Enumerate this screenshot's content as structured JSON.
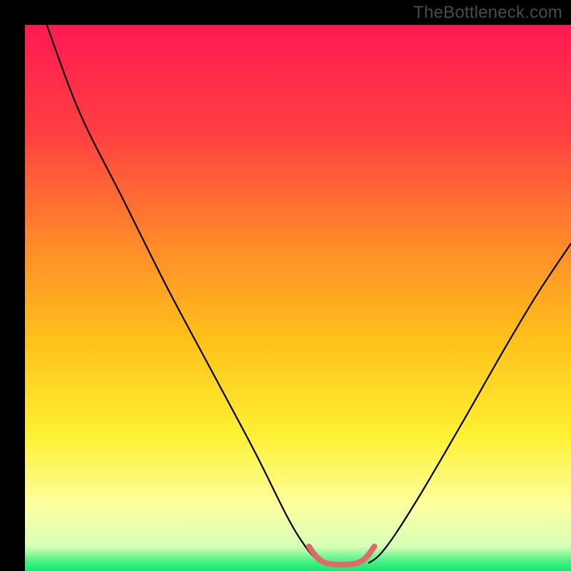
{
  "watermark": "TheBottleneck.com",
  "chart_data": {
    "type": "line",
    "title": "",
    "xlabel": "",
    "ylabel": "",
    "xlim": [
      0,
      100
    ],
    "ylim": [
      0,
      100
    ],
    "grid": false,
    "legend": false,
    "background_gradient": {
      "stops": [
        {
          "offset": 0.0,
          "color": "#ff1a52"
        },
        {
          "offset": 0.2,
          "color": "#ff4040"
        },
        {
          "offset": 0.4,
          "color": "#ff8a2a"
        },
        {
          "offset": 0.58,
          "color": "#ffc21a"
        },
        {
          "offset": 0.75,
          "color": "#fef033"
        },
        {
          "offset": 0.88,
          "color": "#fdffa0"
        },
        {
          "offset": 0.955,
          "color": "#d7ffb6"
        },
        {
          "offset": 0.985,
          "color": "#3df07f"
        },
        {
          "offset": 1.0,
          "color": "#1de573"
        }
      ]
    },
    "series": [
      {
        "name": "left-curve",
        "color": "#000000",
        "x": [
          4.0,
          10.0,
          18.0,
          26.0,
          34.0,
          42.0,
          48.0,
          51.0,
          53.0,
          54.5
        ],
        "values": [
          100.0,
          84.0,
          68.0,
          52.0,
          37.0,
          22.0,
          10.0,
          5.0,
          2.5,
          1.5
        ]
      },
      {
        "name": "right-curve",
        "color": "#000000",
        "x": [
          63.0,
          65.0,
          68.0,
          73.0,
          80.0,
          88.0,
          94.0,
          100.0
        ],
        "values": [
          1.5,
          3.0,
          7.0,
          15.0,
          27.0,
          41.0,
          51.0,
          60.0
        ]
      },
      {
        "name": "valley-highlight",
        "color": "#e06a6a",
        "width": 8,
        "x": [
          52.0,
          53.5,
          55.0,
          57.0,
          59.0,
          61.0,
          62.5,
          64.0
        ],
        "values": [
          4.5,
          2.5,
          1.5,
          1.2,
          1.2,
          1.5,
          2.5,
          4.5
        ]
      }
    ],
    "annotations": []
  }
}
